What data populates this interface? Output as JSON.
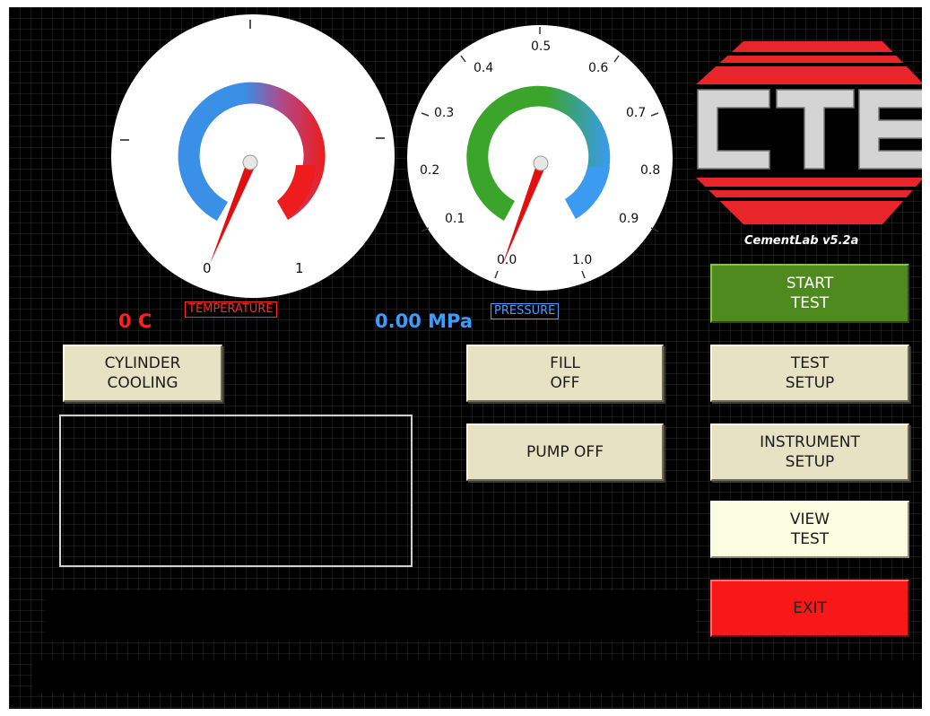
{
  "temperature_gauge": {
    "ticks": [
      "0",
      "1"
    ],
    "label": "TEMPERATURE",
    "readout": "0 C",
    "colors": {
      "cold": "#3a8fe6",
      "hot": "#ee1c1c",
      "needle": "#e01010"
    }
  },
  "pressure_gauge": {
    "ticks": [
      "0.0",
      "0.1",
      "0.2",
      "0.3",
      "0.4",
      "0.5",
      "0.6",
      "0.7",
      "0.8",
      "0.9",
      "1.0"
    ],
    "label": "PRESSURE",
    "readout": "0.00 MPa",
    "colors": {
      "low": "#3aa52a",
      "high": "#3a9bf0",
      "needle": "#e01010"
    }
  },
  "logo": {
    "text": "CTE",
    "version": "CementLab  v5.2a",
    "colors": {
      "red": "#e8252a",
      "grey": "#cfcfcf"
    }
  },
  "buttons": {
    "cylinder_cooling": "CYLINDER\nCOOLING",
    "fill": "FILL\nOFF",
    "pump": "PUMP OFF",
    "start_test": "START\nTEST",
    "test_setup": "TEST\nSETUP",
    "instrument_setup": "INSTRUMENT\nSETUP",
    "view_test": "VIEW\nTEST",
    "exit": "EXIT"
  },
  "colors": {
    "temp_readout": "#ff2020",
    "pressure_readout": "#3d9cff",
    "temp_tag": "#ff2a2a",
    "pressure_tag": "#4d9dff"
  }
}
